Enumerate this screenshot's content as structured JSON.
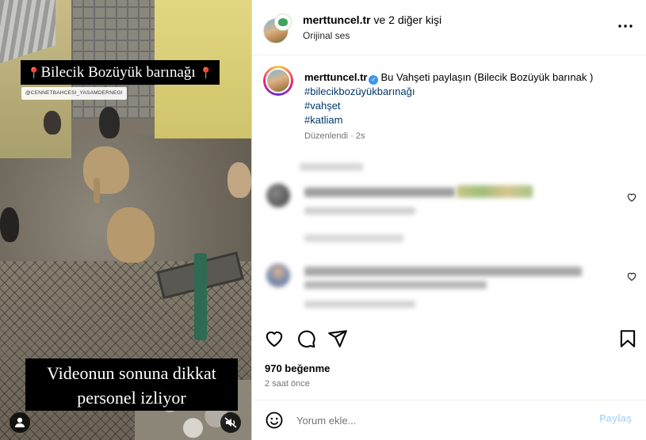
{
  "video": {
    "title": "Bilecik Bozüyük barınağı",
    "watermark": "@CENNETBAHCESI_YASAMDERNEGI",
    "caption_line1": "Videonun sonuna dikkat",
    "caption_line2": "personel izliyor"
  },
  "header": {
    "username": "merttuncel.tr",
    "collab_text": "ve 2 diğer kişi",
    "audio": "Orijinal ses",
    "more_icon": "more-horizontal-icon"
  },
  "caption": {
    "username": "merttuncel.tr",
    "text": "Bu Vahşeti paylaşın (Bilecik Bozüyük barınak )",
    "hashtags": [
      "#bilecikbozüyükbarınağı",
      "#vahşet",
      "#katliam"
    ],
    "edited": "Düzenlendi",
    "age": "2s"
  },
  "actions": {
    "like_icon": "heart-icon",
    "comment_icon": "comment-icon",
    "share_icon": "share-icon",
    "save_icon": "bookmark-icon"
  },
  "stats": {
    "likes": "970 beğenme",
    "time": "2 saat önce"
  },
  "comment_box": {
    "placeholder": "Yorum ekle...",
    "post_label": "Paylaş"
  },
  "colors": {
    "link": "#00376b",
    "verified": "#3897f0",
    "post_disabled": "#b3dbff",
    "muted": "#737373"
  }
}
